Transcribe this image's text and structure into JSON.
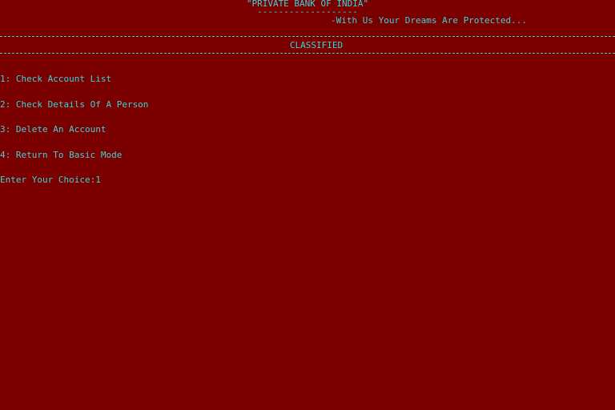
{
  "header": {
    "title": "\"PRIVATE BANK OF INDIA\"",
    "title_underline": "-------------------",
    "tagline": "-With Us Your Dreams Are Protected..."
  },
  "section": {
    "title": "CLASSIFIED"
  },
  "menu": {
    "items": [
      {
        "label": "1: Check Account List"
      },
      {
        "label": "2: Check Details Of A Person"
      },
      {
        "label": "3: Delete An Account"
      },
      {
        "label": "4: Return To Basic Mode"
      }
    ],
    "prompt_label": "Enter Your Choice:",
    "prompt_value": "1"
  },
  "colors": {
    "background": "#7a0000",
    "text": "#3fd0d6"
  }
}
